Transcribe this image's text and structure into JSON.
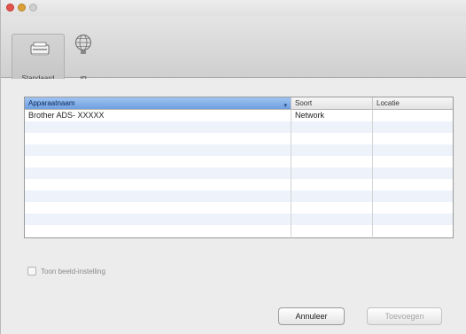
{
  "toolbar": {
    "items": [
      {
        "label": "Standaard",
        "icon": "scanner-icon"
      },
      {
        "label": "IP",
        "icon": "globe-icon"
      }
    ]
  },
  "table": {
    "columns": [
      "Apparaatnaam",
      "Soort",
      "Locatie"
    ],
    "rows": [
      {
        "name": "Brother ADS- XXXXX",
        "type": "Network",
        "location": ""
      },
      {
        "name": "",
        "type": "",
        "location": ""
      },
      {
        "name": "",
        "type": "",
        "location": ""
      },
      {
        "name": "",
        "type": "",
        "location": ""
      },
      {
        "name": "",
        "type": "",
        "location": ""
      },
      {
        "name": "",
        "type": "",
        "location": ""
      },
      {
        "name": "",
        "type": "",
        "location": ""
      },
      {
        "name": "",
        "type": "",
        "location": ""
      },
      {
        "name": "",
        "type": "",
        "location": ""
      },
      {
        "name": "",
        "type": "",
        "location": ""
      },
      {
        "name": "",
        "type": "",
        "location": ""
      }
    ]
  },
  "options": {
    "checkbox_label": "Toon beeld-instelling",
    "checked": false
  },
  "buttons": {
    "cancel_label": "Annuleer",
    "add_label": "Toevoegen"
  },
  "colors": {
    "header_selected": "#6f9fe0",
    "row_stripe": "#eef3fb"
  }
}
